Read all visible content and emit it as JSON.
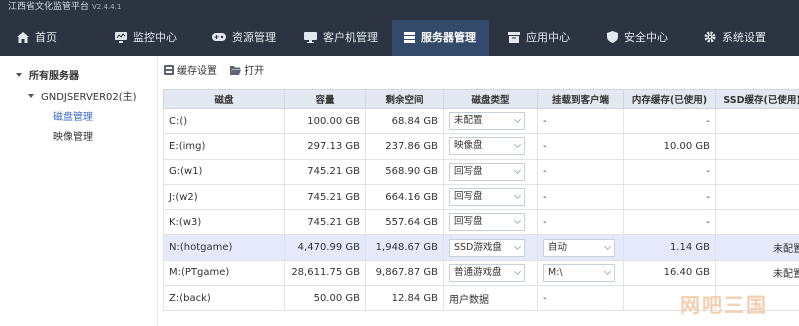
{
  "app": {
    "title": "江西省文化监管平台",
    "version": "V2.4.4.1"
  },
  "nav": [
    {
      "label": "首页",
      "icon": "home-icon"
    },
    {
      "label": "监控中心",
      "icon": "monitor-icon"
    },
    {
      "label": "资源管理",
      "icon": "gamepad-icon"
    },
    {
      "label": "客户机管理",
      "icon": "desktop-icon"
    },
    {
      "label": "服务器管理",
      "icon": "server-icon",
      "active": true
    },
    {
      "label": "应用中心",
      "icon": "app-box-icon"
    },
    {
      "label": "安全中心",
      "icon": "shield-icon"
    },
    {
      "label": "系统设置",
      "icon": "gear-icon"
    }
  ],
  "sidebar": {
    "root": "所有服务器",
    "server": "GNDJSERVER02(主)",
    "items": [
      "磁盘管理",
      "映像管理"
    ]
  },
  "toolbar": {
    "cache_label": "缓存设置",
    "open_label": "打开"
  },
  "table": {
    "headers": [
      "磁盘",
      "容量",
      "剩余空间",
      "磁盘类型",
      "挂载到客户端",
      "内存缓存(已使用)",
      "SSD缓存(已使用)"
    ],
    "rows": [
      {
        "disk": "C:()",
        "capacity": "100.00 GB",
        "free": "68.84 GB",
        "type": "未配置",
        "type_dropdown": true,
        "client": "-",
        "client_dropdown": false,
        "mem": "-",
        "ssd": "-"
      },
      {
        "disk": "E:(img)",
        "capacity": "297.13 GB",
        "free": "237.86 GB",
        "type": "映像盘",
        "type_dropdown": true,
        "client": "-",
        "client_dropdown": false,
        "mem": "10.00 GB",
        "ssd": "-"
      },
      {
        "disk": "G:(w1)",
        "capacity": "745.21 GB",
        "free": "568.90 GB",
        "type": "回写盘",
        "type_dropdown": true,
        "client": "-",
        "client_dropdown": false,
        "mem": "-",
        "ssd": "-"
      },
      {
        "disk": "J:(w2)",
        "capacity": "745.21 GB",
        "free": "664.16 GB",
        "type": "回写盘",
        "type_dropdown": true,
        "client": "-",
        "client_dropdown": false,
        "mem": "-",
        "ssd": "-"
      },
      {
        "disk": "K:(w3)",
        "capacity": "745.21 GB",
        "free": "557.64 GB",
        "type": "回写盘",
        "type_dropdown": true,
        "client": "-",
        "client_dropdown": false,
        "mem": "-",
        "ssd": "-"
      },
      {
        "disk": "N:(hotgame)",
        "capacity": "4,470.99 GB",
        "free": "1,948.67 GB",
        "type": "SSD游戏盘",
        "type_dropdown": true,
        "client": "自动",
        "client_dropdown": true,
        "mem": "1.14 GB",
        "ssd": "未配置",
        "selected": true
      },
      {
        "disk": "M:(PTgame)",
        "capacity": "28,611.75 GB",
        "free": "9,867.87 GB",
        "type": "普通游戏盘",
        "type_dropdown": true,
        "client": "M:\\",
        "client_dropdown": true,
        "mem": "16.40 GB",
        "ssd": "未配置"
      },
      {
        "disk": "Z:(back)",
        "capacity": "50.00 GB",
        "free": "12.84 GB",
        "type": "用户数据",
        "type_dropdown": false,
        "client": "-",
        "client_dropdown": false,
        "mem": "",
        "ssd": ""
      }
    ]
  },
  "watermark": "网吧三国",
  "colors": {
    "topbar": "#2b3440",
    "active_tab": "#344a6b",
    "header_bg": "#e4e9f1",
    "selected_row": "#e6e9fb",
    "link": "#3b6cc9"
  }
}
